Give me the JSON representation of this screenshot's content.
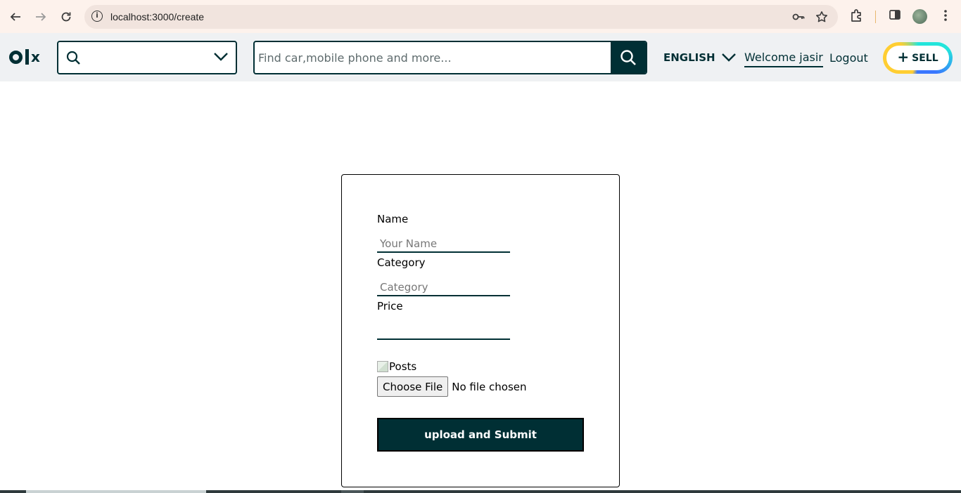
{
  "browser": {
    "url": "localhost:3000/create",
    "back_icon": "arrow-left",
    "forward_icon": "arrow-right",
    "reload_icon": "reload",
    "info_icon": "info",
    "key_icon": "key",
    "star_icon": "star",
    "extensions_icon": "puzzle",
    "sidepanel_icon": "sidepanel",
    "menu_icon": "kebab-menu"
  },
  "header": {
    "logo_text": "OLX",
    "search_placeholder": "Find car,mobile phone and more...",
    "language": "ENGLISH",
    "welcome": "Welcome jasir",
    "logout": "Logout",
    "sell_label": "SELL",
    "sell_plus": "+",
    "colors": {
      "primary": "#002f34",
      "sell_yellow": "#ffce32",
      "sell_cyan": "#23e5db",
      "sell_blue": "#3a77ff"
    }
  },
  "form": {
    "name_label": "Name",
    "name_placeholder": "Your Name",
    "category_label": "Category",
    "category_placeholder": "Category",
    "price_label": "Price",
    "price_value": "",
    "image_alt": "Posts",
    "file_button": "Choose File",
    "file_status": "No file chosen",
    "submit_label": "upload and Submit"
  }
}
